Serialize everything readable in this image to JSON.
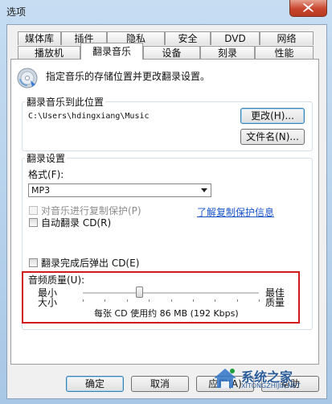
{
  "window": {
    "title": "选项"
  },
  "tabs_top": [
    {
      "label": "媒体库"
    },
    {
      "label": "插件"
    },
    {
      "label": "隐私"
    },
    {
      "label": "安全"
    },
    {
      "label": "DVD"
    },
    {
      "label": "网络"
    }
  ],
  "tabs_bottom": [
    {
      "label": "播放机"
    },
    {
      "label": "翻录音乐",
      "active": true
    },
    {
      "label": "设备"
    },
    {
      "label": "刻录"
    },
    {
      "label": "性能"
    }
  ],
  "panel": {
    "description": "指定音乐的存储位置并更改翻录设置。",
    "location_group": {
      "label": "翻录音乐到此位置",
      "path": "C:\\Users\\hdingxiang\\Music",
      "change_button": "更改(H)...",
      "filename_button": "文件名(N)..."
    },
    "settings_group": {
      "label": "翻录设置",
      "format_label": "格式(F):",
      "format_value": "MP3",
      "copy_protect": {
        "label": "对音乐进行复制保护(P)",
        "checked": false,
        "disabled": true
      },
      "copy_protect_link": "了解复制保护信息",
      "auto_rip": {
        "label": "自动翻录 CD(R)",
        "checked": false
      },
      "eject": {
        "label": "翻录完成后弹出 CD(E)",
        "checked": false
      },
      "quality_label": "音频质量(U):",
      "quality_min_1": "最小",
      "quality_min_2": "大小",
      "quality_max_1": "最佳",
      "quality_max_2": "质量",
      "quality_info": "每张 CD 使用约 86 MB (192 Kbps)",
      "quality_level": 0.32
    }
  },
  "footer": {
    "ok": "确定",
    "cancel": "取消",
    "apply": "应用(A)",
    "help": "帮助"
  },
  "watermark": {
    "text": "系统之家",
    "url": "XITONGZHIJIA.NET"
  },
  "colors": {
    "highlight_box": "#d21a1a",
    "link": "#1a55c8",
    "close_button": "#c8452e"
  }
}
